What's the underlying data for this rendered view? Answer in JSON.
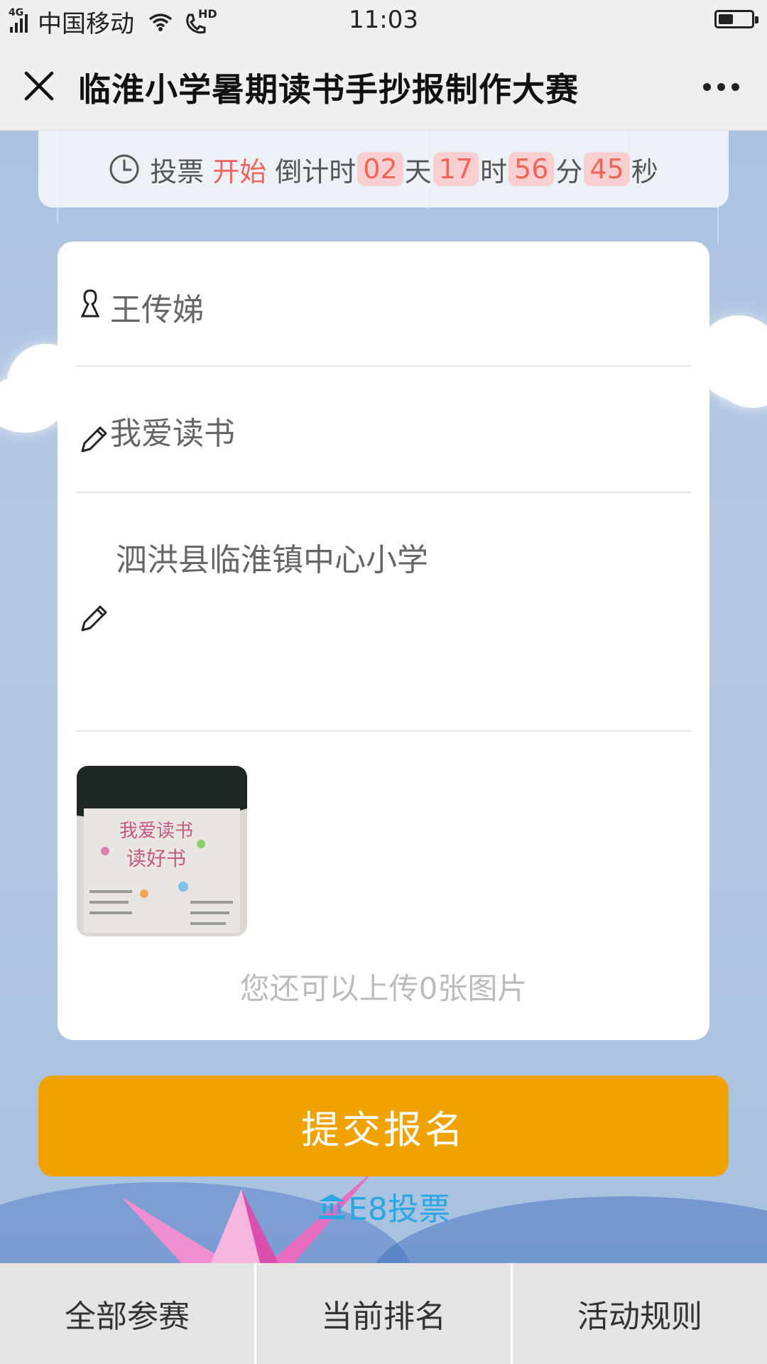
{
  "status_bar": {
    "network": "4G",
    "carrier": "中国移动",
    "hd": "HD",
    "time": "11:03",
    "battery_level": 0.45
  },
  "header": {
    "title": "临淮小学暑期读书手抄报制作大赛"
  },
  "countdown": {
    "prefix": "投票",
    "highlight": "开始",
    "label": "倒计时",
    "days": "02",
    "days_unit": "天",
    "hours": "17",
    "hours_unit": "时",
    "minutes": "56",
    "minutes_unit": "分",
    "seconds": "45",
    "seconds_unit": "秒"
  },
  "form": {
    "name_value": "王传娣",
    "title_value": "我爱读书",
    "school_value": "泗洪县临淮镇中心小学",
    "upload_hint": "您还可以上传0张图片"
  },
  "submit_label": "提交报名",
  "brand_label": "E8投票",
  "tabs": [
    {
      "label": "全部参赛"
    },
    {
      "label": "当前排名"
    },
    {
      "label": "活动规则"
    }
  ],
  "colors": {
    "accent": "#f0a200",
    "highlight": "#f0645c",
    "brand": "#2aa6e0"
  }
}
